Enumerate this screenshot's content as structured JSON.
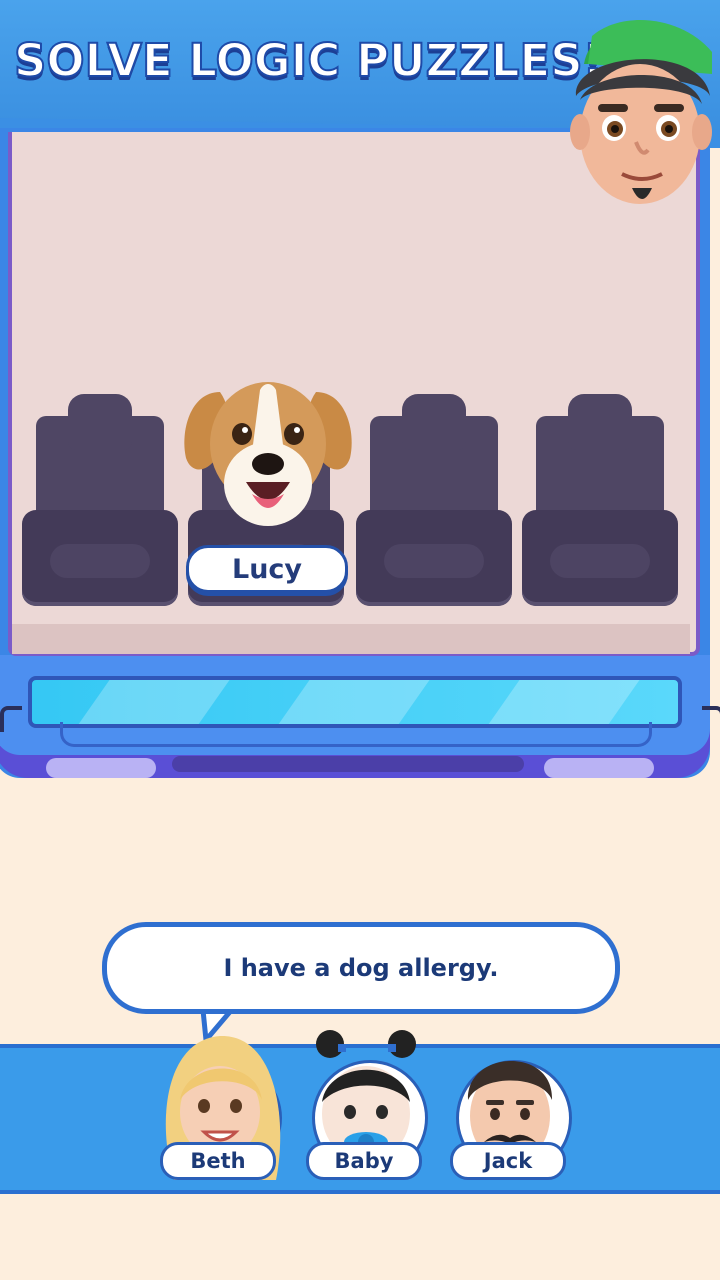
{
  "header": {
    "title": "SOLVE LOGIC PUZZLES!"
  },
  "host": {
    "icon": "host-avatar-icon"
  },
  "vehicle": {
    "seats": [
      {
        "occupant": ""
      },
      {
        "occupant": "Lucy"
      },
      {
        "occupant": ""
      },
      {
        "occupant": ""
      }
    ]
  },
  "speech": {
    "text": "I have a dog allergy."
  },
  "characters": [
    {
      "name": "Beth"
    },
    {
      "name": "Baby"
    },
    {
      "name": "Jack"
    }
  ],
  "colors": {
    "banner": "#3a8fe0",
    "interior": "#ecd8d6",
    "seat": "#4f4664",
    "panel": "#3a9bea",
    "background": "#fdeedd"
  }
}
